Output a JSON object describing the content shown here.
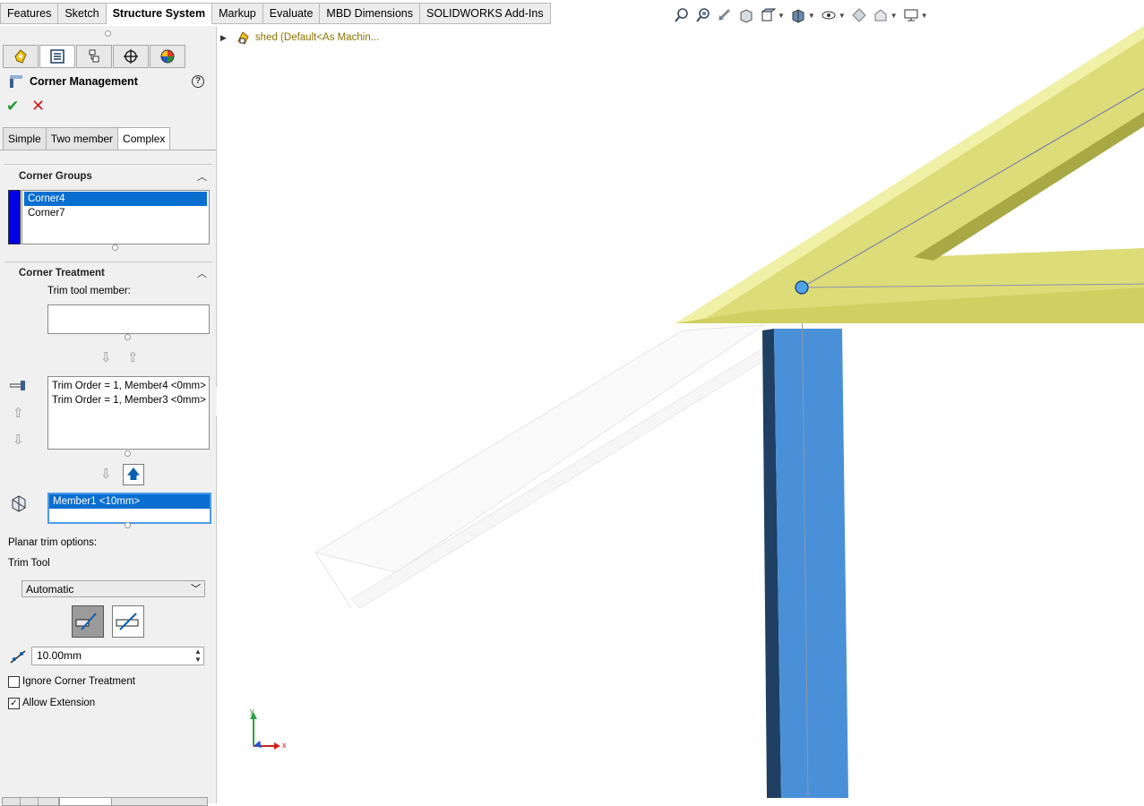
{
  "ribbon": {
    "tabs": [
      {
        "label": "Features"
      },
      {
        "label": "Sketch"
      },
      {
        "label": "Structure System"
      },
      {
        "label": "Markup"
      },
      {
        "label": "Evaluate"
      },
      {
        "label": "MBD Dimensions"
      },
      {
        "label": "SOLIDWORKS Add-Ins"
      }
    ],
    "active_tab": "Structure System"
  },
  "hud_toolbar": {
    "icons": [
      "zoom-to-fit-icon",
      "zoom-to-area-icon",
      "previous-view-icon",
      "section-view-icon",
      "view-orientation-icon",
      "display-style-icon",
      "hide-show-items-icon",
      "edit-appearance-icon",
      "apply-scene-icon",
      "view-settings-icon"
    ]
  },
  "feature_tree": {
    "node_label": "shed  (Default<As Machin..."
  },
  "property_manager": {
    "title": "Corner Management",
    "subtabs": [
      "Simple",
      "Two member",
      "Complex"
    ],
    "active_subtab": "Complex",
    "corner_groups": {
      "header": "Corner Groups",
      "items": [
        "Corner4",
        "Corner7"
      ],
      "selected": "Corner4",
      "swatch_color": "#0000e6"
    },
    "corner_treatment": {
      "header": "Corner Treatment",
      "trim_tool_label": "Trim tool member:",
      "trim_tool_value": "",
      "trim_order_items": [
        "Trim Order = 1, Member4   <0mm>",
        "Trim Order = 1, Member3   <0mm>"
      ],
      "member_items": [
        "Member1   <10mm>"
      ],
      "planar_trim_label": "Planar trim options:",
      "trim_tool_heading": "Trim Tool",
      "trim_tool_select": "Automatic",
      "gap_value": "10.00mm",
      "ignore_corner_label": "Ignore Corner Treatment",
      "ignore_corner_checked": false,
      "allow_extension_label": "Allow Extension",
      "allow_extension_checked": true
    }
  },
  "triad": {
    "x": "x",
    "y": "y"
  },
  "colors": {
    "yellow_member": "#dcdc78",
    "blue_member": "#4a90d9",
    "selection_blue": "#0a6ed1"
  }
}
